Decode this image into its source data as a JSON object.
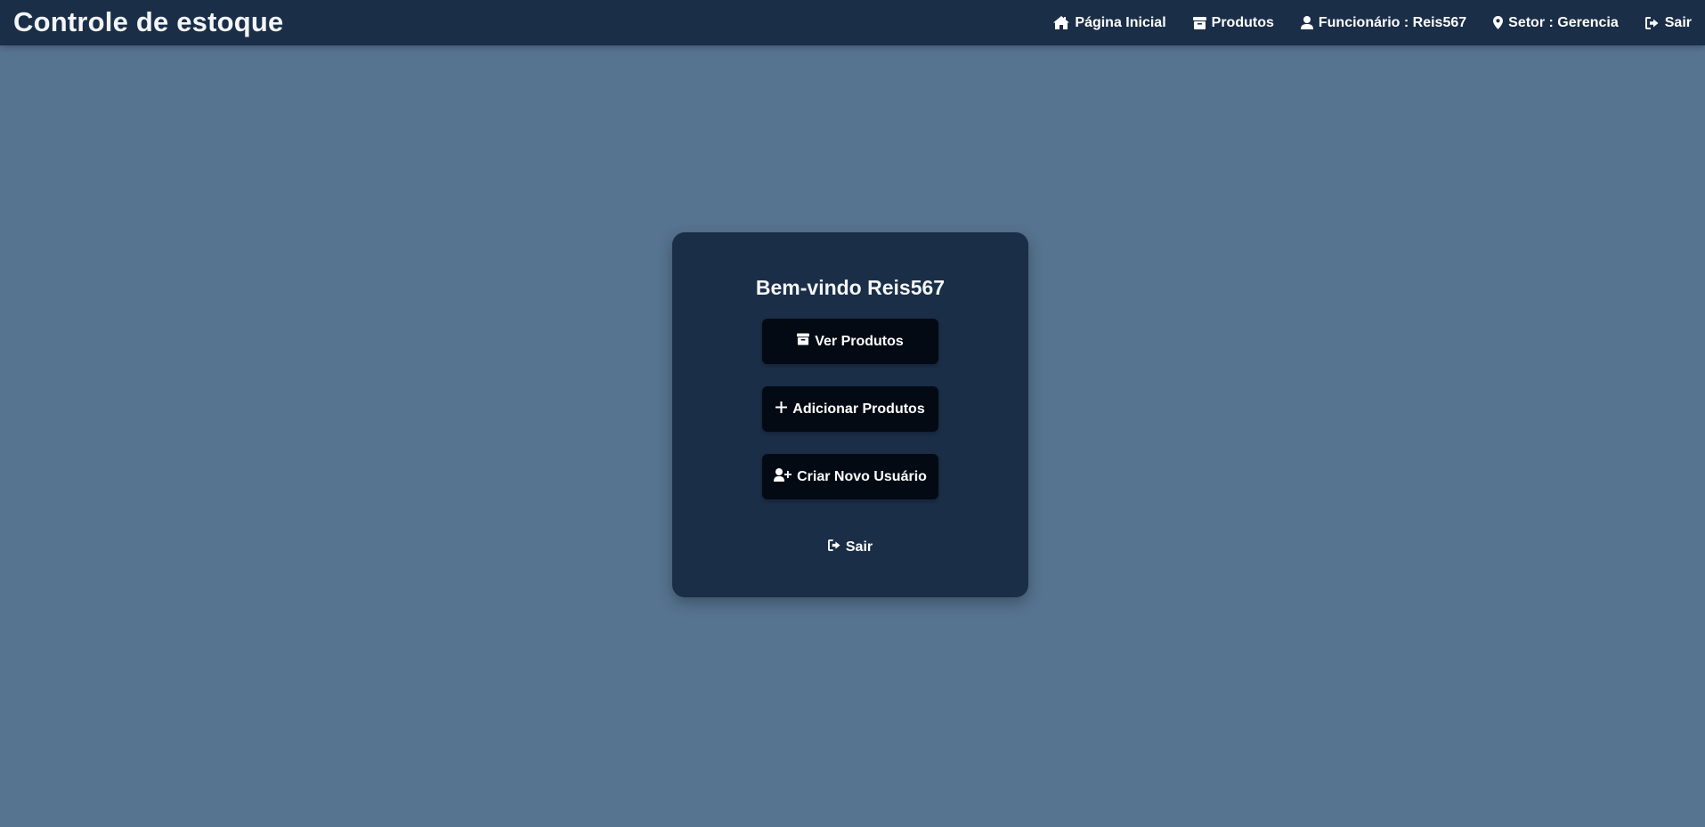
{
  "navbar": {
    "brand": "Controle de estoque",
    "links": [
      {
        "label": "Página Inicial",
        "icon": "home-icon"
      },
      {
        "label": "Produtos",
        "icon": "box-icon"
      },
      {
        "label": "Funcionário : Reis567",
        "icon": "user-icon"
      },
      {
        "label": "Setor : Gerencia",
        "icon": "map-marker-icon"
      },
      {
        "label": "Sair",
        "icon": "sign-out-icon"
      }
    ]
  },
  "card": {
    "welcome": "Bem-vindo Reis567",
    "buttons": [
      {
        "label": "Ver Produtos",
        "icon": "box-icon"
      },
      {
        "label": "Adicionar Produtos",
        "icon": "plus-icon"
      },
      {
        "label": "Criar Novo Usuário",
        "icon": "user-plus-icon"
      }
    ],
    "logout_label": "Sair",
    "logout_icon": "sign-out-icon"
  },
  "colors": {
    "background": "#56738f",
    "navbar": "#1a2e47",
    "card": "#1a2e47",
    "button": "#030a14",
    "text": "#ffffff"
  }
}
